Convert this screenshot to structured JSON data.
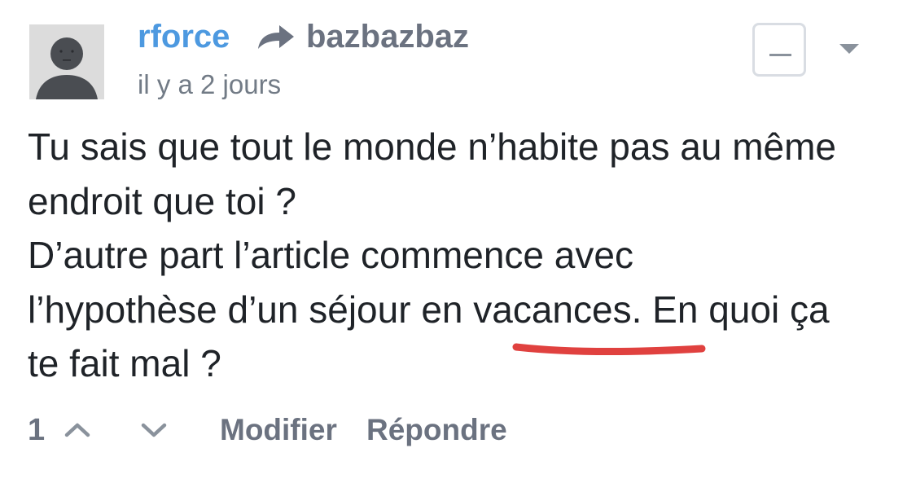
{
  "comment": {
    "author": "rforce",
    "reply_to": "bazbazbaz",
    "timestamp": "il y a 2 jours",
    "body_lines": [
      "Tu sais que tout le monde n’habite pas au même",
      "endroit que toi ?",
      "D’autre part l’article commence avec",
      "l’hypothèse d’un séjour en vacances. En quoi ça",
      "te fait mal ?"
    ],
    "highlighted_word": "vacances",
    "highlight_color": "#e0413f",
    "vote_count": "1",
    "actions": {
      "edit_label": "Modifier",
      "reply_label": "Répondre"
    }
  },
  "icons": {
    "avatar": "default-user-avatar",
    "reply_arrow": "share-arrow-icon",
    "collapse": "minus-square-icon",
    "menu": "caret-down-icon",
    "upvote": "chevron-up-icon",
    "downvote": "chevron-down-icon"
  },
  "colors": {
    "author": "#4d99e0",
    "muted": "#6b7280",
    "text": "#1f2328",
    "background": "#ffffff"
  }
}
